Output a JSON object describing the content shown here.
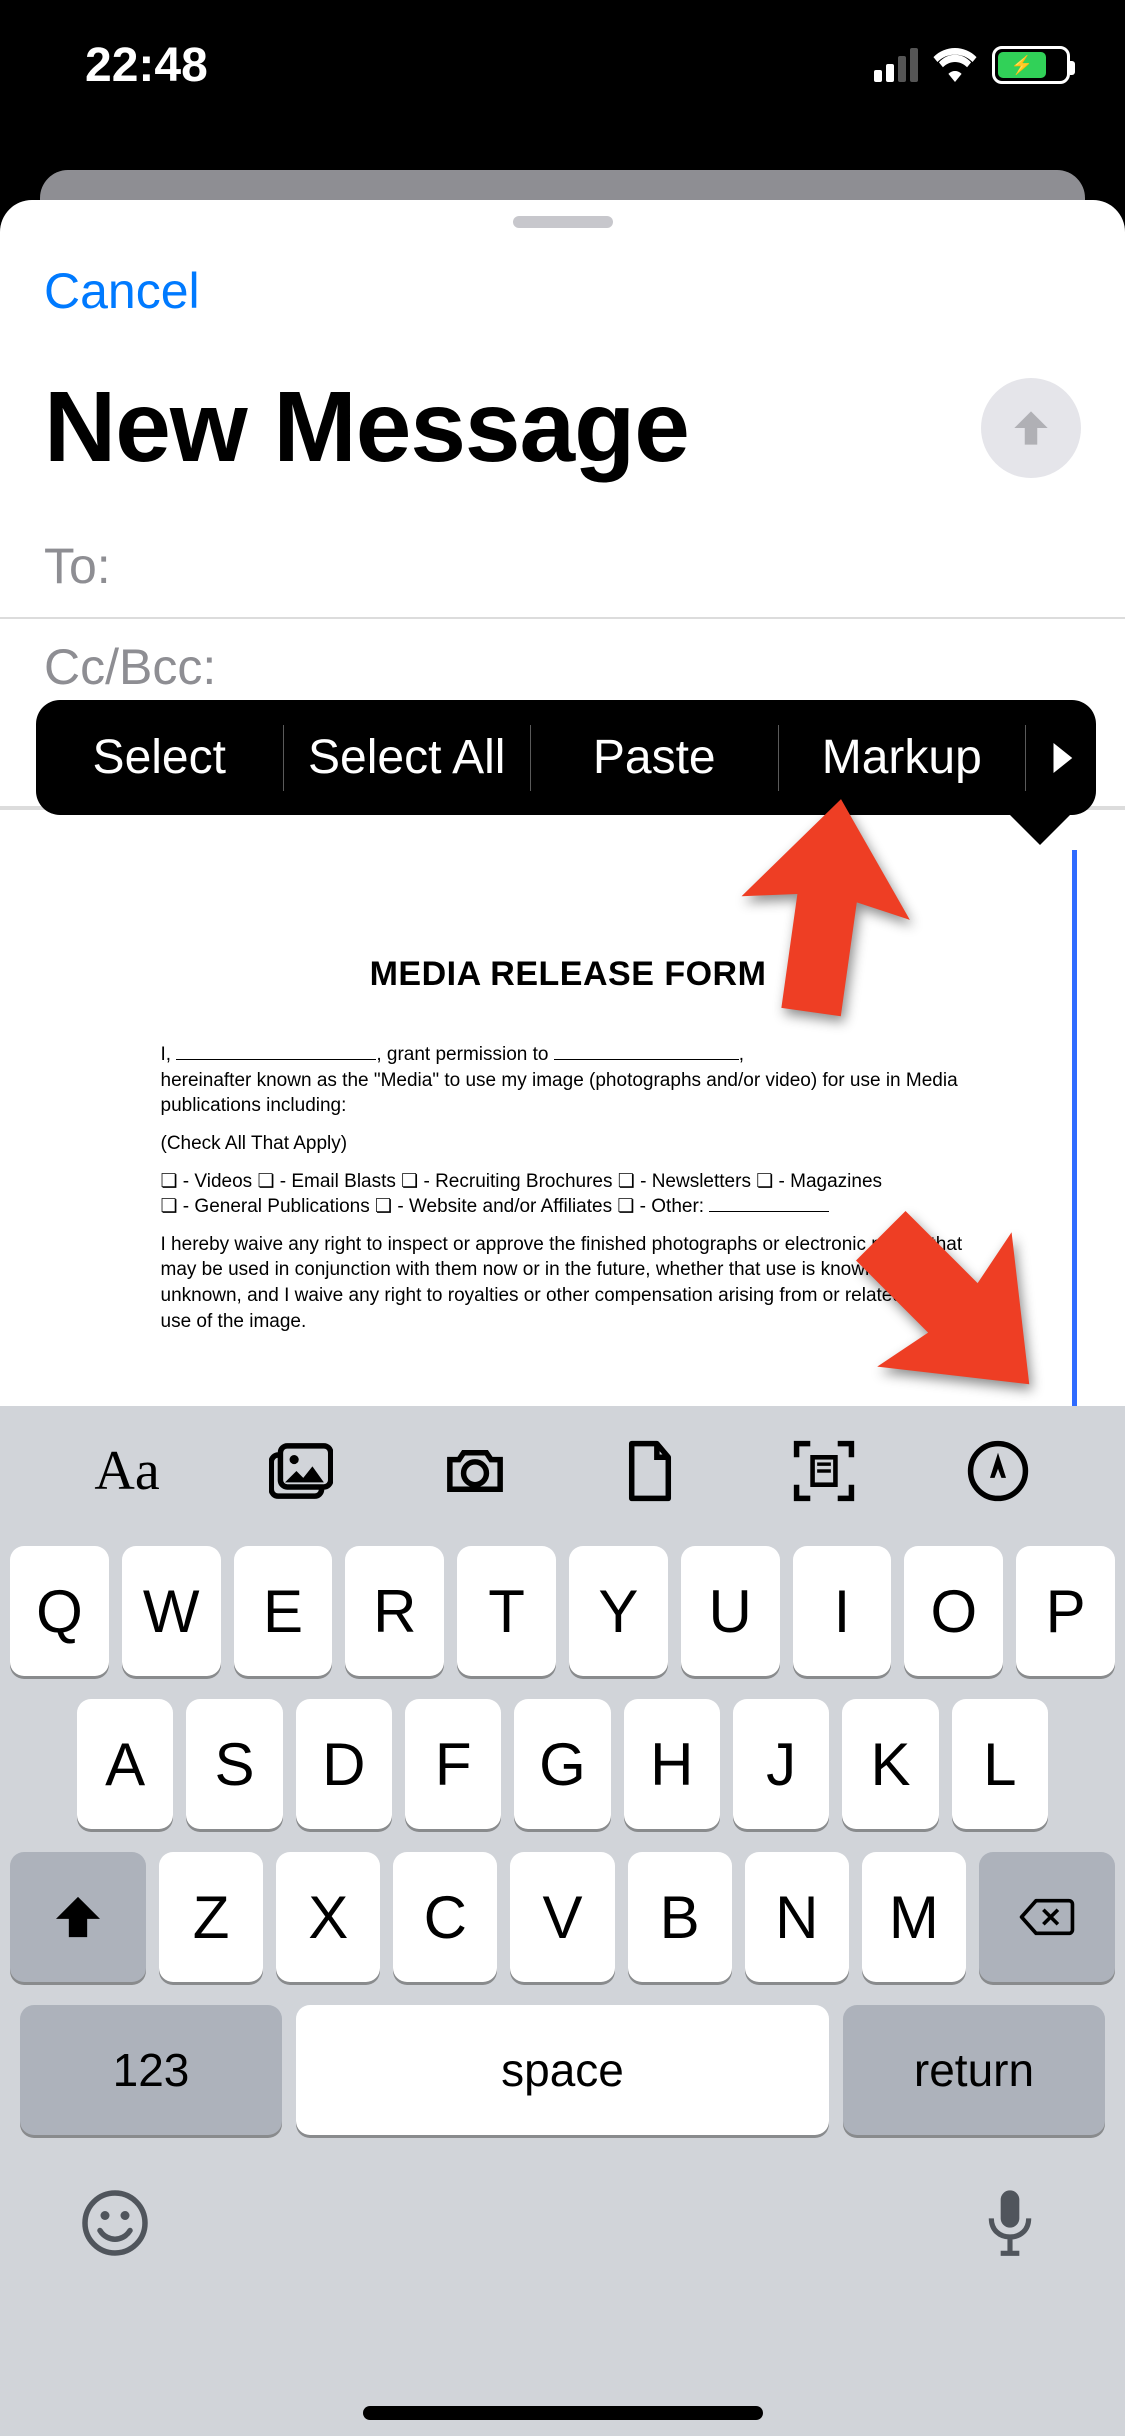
{
  "status": {
    "time": "22:48"
  },
  "sheet": {
    "cancel": "Cancel",
    "title": "New Message",
    "to_label": "To:",
    "ccbcc_label": "Cc/Bcc:"
  },
  "context_menu": {
    "items": [
      "Select",
      "Select All",
      "Paste",
      "Markup"
    ]
  },
  "document": {
    "title": "MEDIA RELEASE FORM",
    "line1_a": "I,",
    "line1_b": ", grant permission to",
    "line1_c": ",",
    "line2": "hereinafter known as the \"Media\" to use my image (photographs and/or video) for use in Media publications including:",
    "check_label": "(Check All That Apply)",
    "opts1": "❏ - Videos  ❏ - Email Blasts  ❏ - Recruiting Brochures  ❏ - Newsletters  ❏ - Magazines",
    "opts2_a": "❏ - General Publications  ❏ - Website and/or Affiliates  ❏ - Other:",
    "waiver": "I hereby waive any right to inspect or approve the finished photographs or electronic matter that may be used in conjunction with them now or in the future, whether that use is known to me or unknown, and I waive any right to royalties or other compensation arising from or related to the use of the image."
  },
  "keyboard": {
    "toolbar": [
      "format",
      "photos",
      "camera",
      "file",
      "scan",
      "markup"
    ],
    "row1": [
      "Q",
      "W",
      "E",
      "R",
      "T",
      "Y",
      "U",
      "I",
      "O",
      "P"
    ],
    "row2": [
      "A",
      "S",
      "D",
      "F",
      "G",
      "H",
      "J",
      "K",
      "L"
    ],
    "row3": [
      "Z",
      "X",
      "C",
      "V",
      "B",
      "N",
      "M"
    ],
    "numbers": "123",
    "space": "space",
    "return": "return"
  }
}
